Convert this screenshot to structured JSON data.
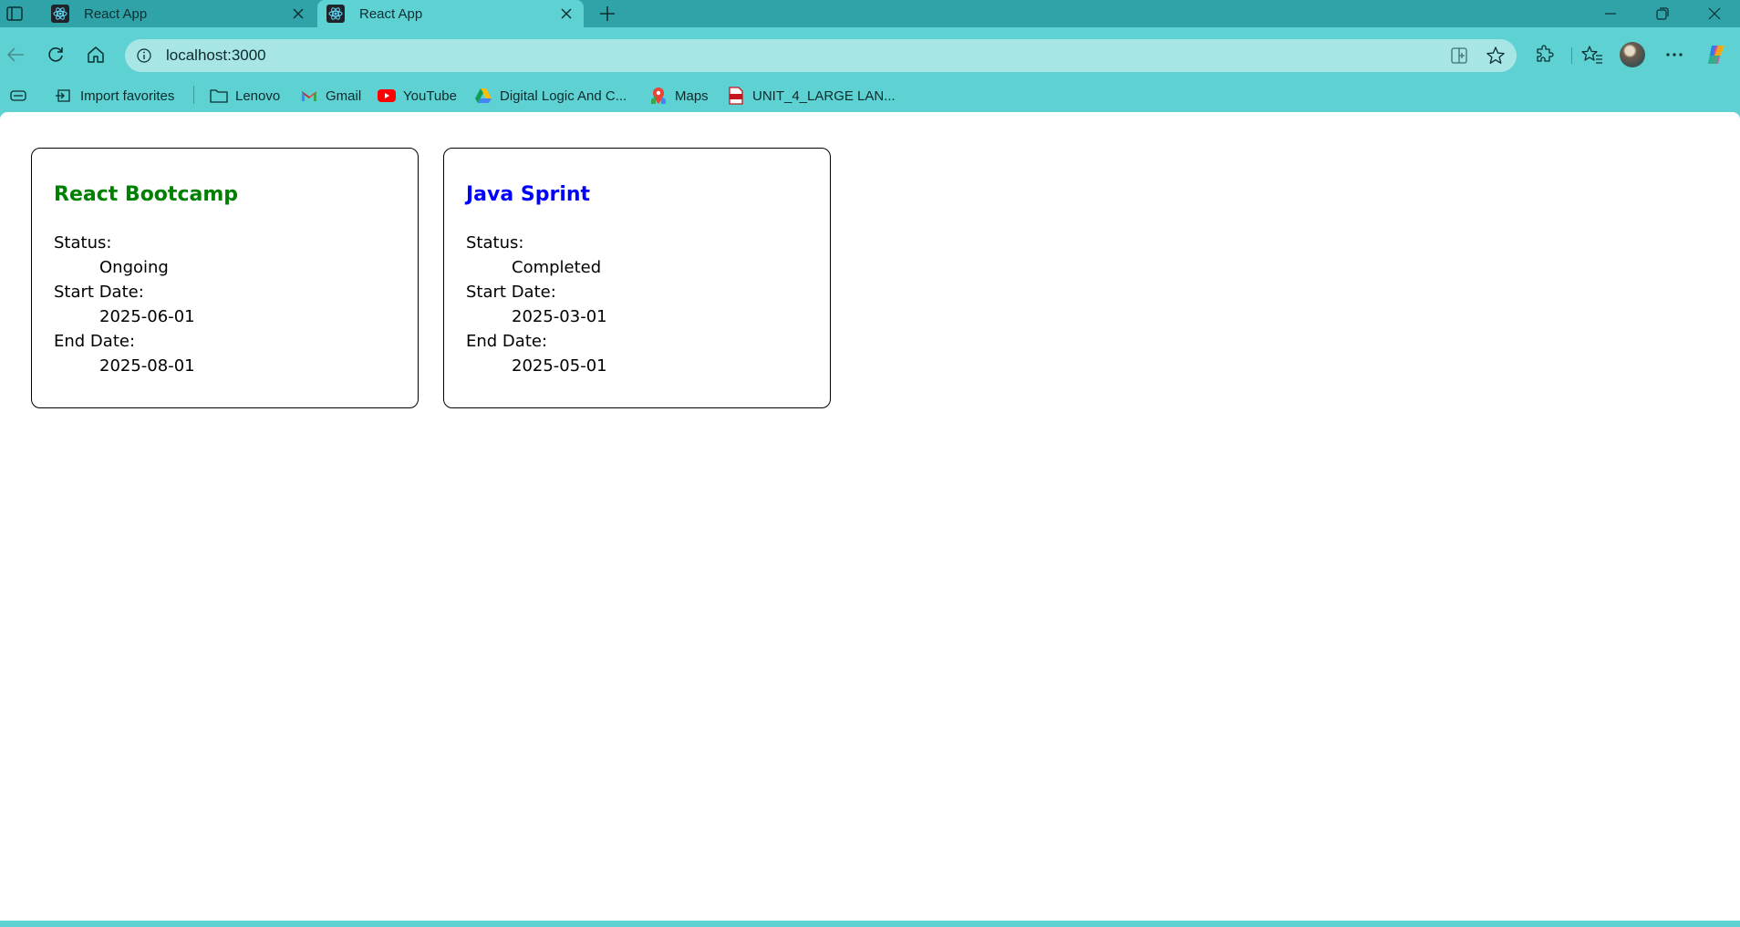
{
  "browser": {
    "tabs": [
      {
        "title": "React App",
        "active": false
      },
      {
        "title": "React App",
        "active": true
      }
    ],
    "address_url": "localhost:3000",
    "favorites": [
      {
        "label": "Import favorites",
        "icon": "import-icon"
      },
      {
        "label": "Lenovo",
        "icon": "folder-icon"
      },
      {
        "label": "Gmail",
        "icon": "gmail-icon"
      },
      {
        "label": "YouTube",
        "icon": "youtube-icon"
      },
      {
        "label": "Digital Logic And C...",
        "icon": "google-drive-icon"
      },
      {
        "label": "Maps",
        "icon": "maps-icon"
      },
      {
        "label": "UNIT_4_LARGE LAN...",
        "icon": "pdf-icon"
      }
    ]
  },
  "cards": [
    {
      "title": "React Bootcamp",
      "title_color": "#008000",
      "status_label": "Status:",
      "status": "Ongoing",
      "start_label": "Start Date:",
      "start_date": "2025-06-01",
      "end_label": "End Date:",
      "end_date": "2025-08-01"
    },
    {
      "title": "Java Sprint",
      "title_color": "#0000ff",
      "status_label": "Status:",
      "status": "Completed",
      "start_label": "Start Date:",
      "start_date": "2025-03-01",
      "end_label": "End Date:",
      "end_date": "2025-05-01"
    }
  ],
  "colors": {
    "frame": "#5ed2d2",
    "tabstrip": "#2fa3a8",
    "addressbar": "#a8e6e6"
  }
}
